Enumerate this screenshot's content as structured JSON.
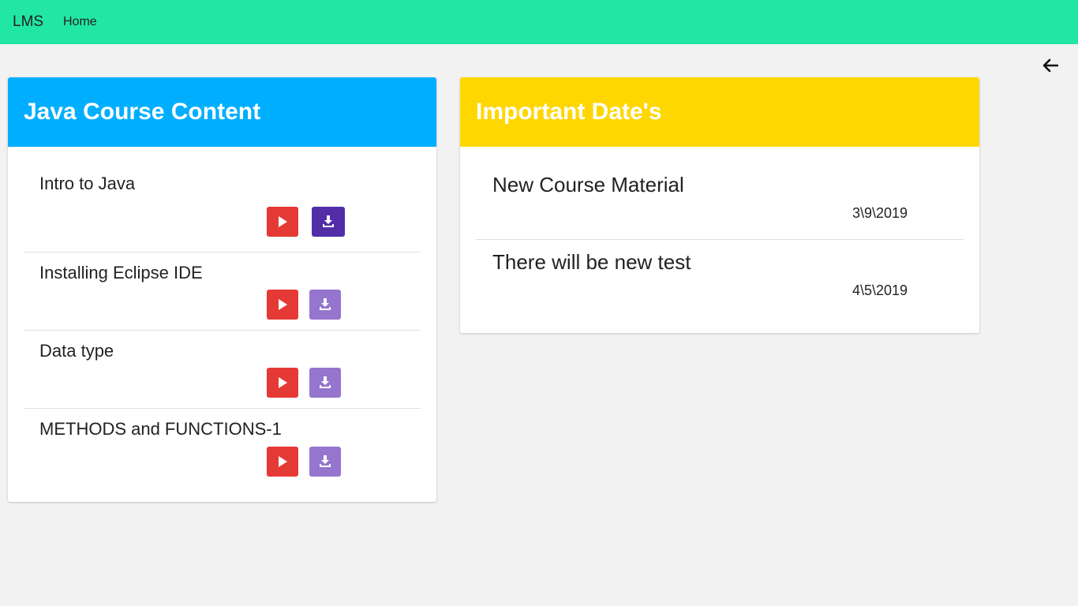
{
  "navbar": {
    "brand": "LMS",
    "home_label": "Home",
    "color": "#21e6a4"
  },
  "back": {
    "icon": "arrow-left-icon"
  },
  "course": {
    "title": "Java Course Content",
    "header_color": "#00aeff",
    "lessons": [
      {
        "title": "Intro to Java",
        "play_icon": "play-icon",
        "download_icon": "download-icon"
      },
      {
        "title": "Installing Eclipse IDE",
        "play_icon": "play-icon",
        "download_icon": "download-icon"
      },
      {
        "title": "Data type",
        "play_icon": "play-icon",
        "download_icon": "download-icon"
      },
      {
        "title": "METHODS and FUNCTIONS-1",
        "play_icon": "play-icon",
        "download_icon": "download-icon"
      }
    ],
    "play_color": "#e53935",
    "download_color": "#9575cd",
    "download_active_color": "#512da8"
  },
  "dates": {
    "title": "Important Date's",
    "header_color": "#ffd700",
    "items": [
      {
        "title": "New Course Material",
        "date": "3\\9\\2019"
      },
      {
        "title": "There will be new test",
        "date": "4\\5\\2019"
      }
    ]
  }
}
